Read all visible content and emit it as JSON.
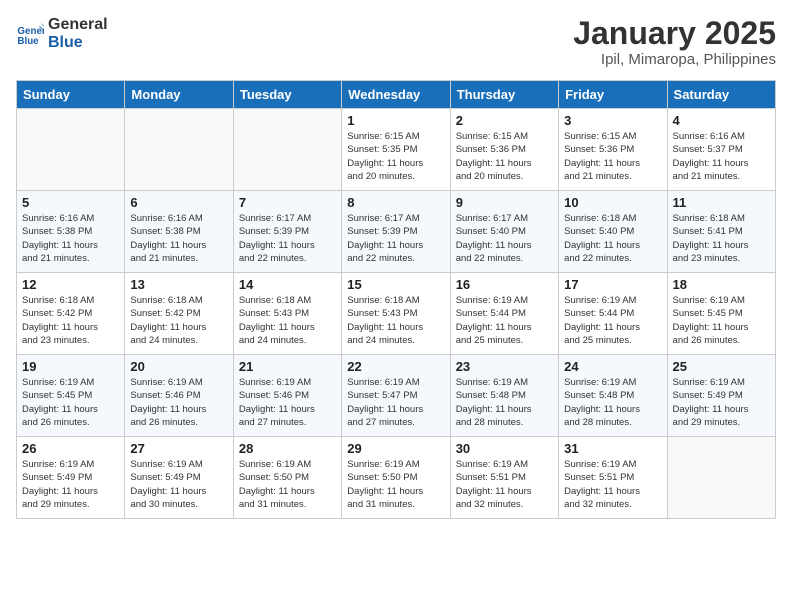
{
  "logo": {
    "line1": "General",
    "line2": "Blue"
  },
  "title": "January 2025",
  "subtitle": "Ipil, Mimaropa, Philippines",
  "weekdays": [
    "Sunday",
    "Monday",
    "Tuesday",
    "Wednesday",
    "Thursday",
    "Friday",
    "Saturday"
  ],
  "weeks": [
    [
      {
        "day": "",
        "info": ""
      },
      {
        "day": "",
        "info": ""
      },
      {
        "day": "",
        "info": ""
      },
      {
        "day": "1",
        "info": "Sunrise: 6:15 AM\nSunset: 5:35 PM\nDaylight: 11 hours\nand 20 minutes."
      },
      {
        "day": "2",
        "info": "Sunrise: 6:15 AM\nSunset: 5:36 PM\nDaylight: 11 hours\nand 20 minutes."
      },
      {
        "day": "3",
        "info": "Sunrise: 6:15 AM\nSunset: 5:36 PM\nDaylight: 11 hours\nand 21 minutes."
      },
      {
        "day": "4",
        "info": "Sunrise: 6:16 AM\nSunset: 5:37 PM\nDaylight: 11 hours\nand 21 minutes."
      }
    ],
    [
      {
        "day": "5",
        "info": "Sunrise: 6:16 AM\nSunset: 5:38 PM\nDaylight: 11 hours\nand 21 minutes."
      },
      {
        "day": "6",
        "info": "Sunrise: 6:16 AM\nSunset: 5:38 PM\nDaylight: 11 hours\nand 21 minutes."
      },
      {
        "day": "7",
        "info": "Sunrise: 6:17 AM\nSunset: 5:39 PM\nDaylight: 11 hours\nand 22 minutes."
      },
      {
        "day": "8",
        "info": "Sunrise: 6:17 AM\nSunset: 5:39 PM\nDaylight: 11 hours\nand 22 minutes."
      },
      {
        "day": "9",
        "info": "Sunrise: 6:17 AM\nSunset: 5:40 PM\nDaylight: 11 hours\nand 22 minutes."
      },
      {
        "day": "10",
        "info": "Sunrise: 6:18 AM\nSunset: 5:40 PM\nDaylight: 11 hours\nand 22 minutes."
      },
      {
        "day": "11",
        "info": "Sunrise: 6:18 AM\nSunset: 5:41 PM\nDaylight: 11 hours\nand 23 minutes."
      }
    ],
    [
      {
        "day": "12",
        "info": "Sunrise: 6:18 AM\nSunset: 5:42 PM\nDaylight: 11 hours\nand 23 minutes."
      },
      {
        "day": "13",
        "info": "Sunrise: 6:18 AM\nSunset: 5:42 PM\nDaylight: 11 hours\nand 24 minutes."
      },
      {
        "day": "14",
        "info": "Sunrise: 6:18 AM\nSunset: 5:43 PM\nDaylight: 11 hours\nand 24 minutes."
      },
      {
        "day": "15",
        "info": "Sunrise: 6:18 AM\nSunset: 5:43 PM\nDaylight: 11 hours\nand 24 minutes."
      },
      {
        "day": "16",
        "info": "Sunrise: 6:19 AM\nSunset: 5:44 PM\nDaylight: 11 hours\nand 25 minutes."
      },
      {
        "day": "17",
        "info": "Sunrise: 6:19 AM\nSunset: 5:44 PM\nDaylight: 11 hours\nand 25 minutes."
      },
      {
        "day": "18",
        "info": "Sunrise: 6:19 AM\nSunset: 5:45 PM\nDaylight: 11 hours\nand 26 minutes."
      }
    ],
    [
      {
        "day": "19",
        "info": "Sunrise: 6:19 AM\nSunset: 5:45 PM\nDaylight: 11 hours\nand 26 minutes."
      },
      {
        "day": "20",
        "info": "Sunrise: 6:19 AM\nSunset: 5:46 PM\nDaylight: 11 hours\nand 26 minutes."
      },
      {
        "day": "21",
        "info": "Sunrise: 6:19 AM\nSunset: 5:46 PM\nDaylight: 11 hours\nand 27 minutes."
      },
      {
        "day": "22",
        "info": "Sunrise: 6:19 AM\nSunset: 5:47 PM\nDaylight: 11 hours\nand 27 minutes."
      },
      {
        "day": "23",
        "info": "Sunrise: 6:19 AM\nSunset: 5:48 PM\nDaylight: 11 hours\nand 28 minutes."
      },
      {
        "day": "24",
        "info": "Sunrise: 6:19 AM\nSunset: 5:48 PM\nDaylight: 11 hours\nand 28 minutes."
      },
      {
        "day": "25",
        "info": "Sunrise: 6:19 AM\nSunset: 5:49 PM\nDaylight: 11 hours\nand 29 minutes."
      }
    ],
    [
      {
        "day": "26",
        "info": "Sunrise: 6:19 AM\nSunset: 5:49 PM\nDaylight: 11 hours\nand 29 minutes."
      },
      {
        "day": "27",
        "info": "Sunrise: 6:19 AM\nSunset: 5:49 PM\nDaylight: 11 hours\nand 30 minutes."
      },
      {
        "day": "28",
        "info": "Sunrise: 6:19 AM\nSunset: 5:50 PM\nDaylight: 11 hours\nand 31 minutes."
      },
      {
        "day": "29",
        "info": "Sunrise: 6:19 AM\nSunset: 5:50 PM\nDaylight: 11 hours\nand 31 minutes."
      },
      {
        "day": "30",
        "info": "Sunrise: 6:19 AM\nSunset: 5:51 PM\nDaylight: 11 hours\nand 32 minutes."
      },
      {
        "day": "31",
        "info": "Sunrise: 6:19 AM\nSunset: 5:51 PM\nDaylight: 11 hours\nand 32 minutes."
      },
      {
        "day": "",
        "info": ""
      }
    ]
  ]
}
